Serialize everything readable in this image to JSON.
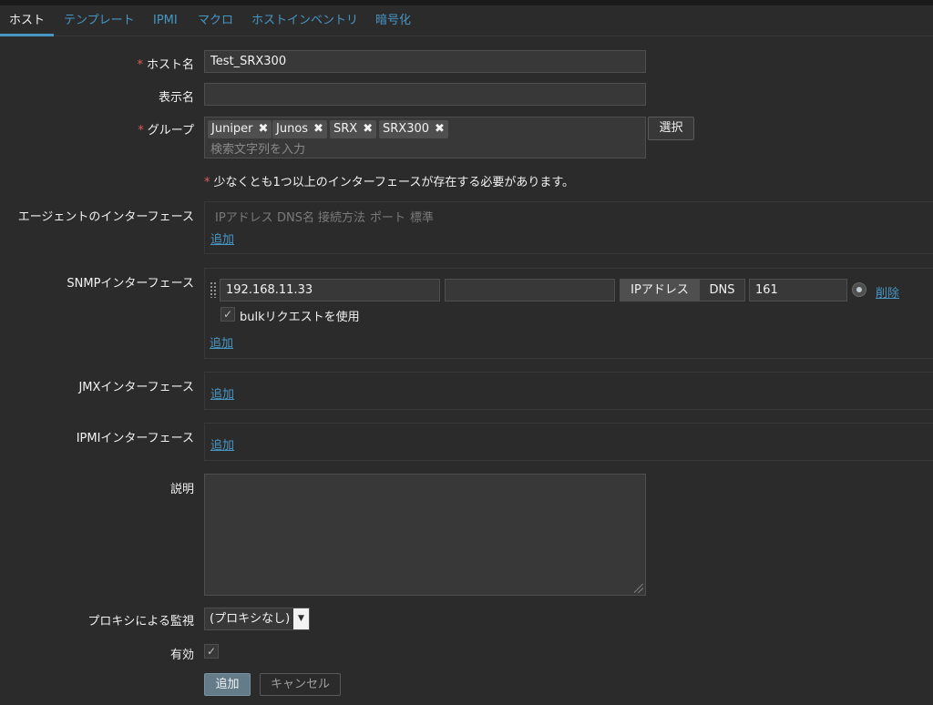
{
  "tabs": [
    "ホスト",
    "テンプレート",
    "IPMI",
    "マクロ",
    "ホストインベントリ",
    "暗号化"
  ],
  "host_name": {
    "label": "ホスト名",
    "value": "Test_SRX300"
  },
  "visible_name": {
    "label": "表示名",
    "value": ""
  },
  "groups": {
    "label": "グループ",
    "tags": [
      "Juniper",
      "Junos",
      "SRX",
      "SRX300"
    ],
    "tag_remove_icon": "✖",
    "search_placeholder": "検索文字列を入力",
    "select_button": "選択"
  },
  "interface_notice": "少なくとも1つ以上のインターフェースが存在する必要があります。",
  "required_marker": "*",
  "agent_interfaces": {
    "label": "エージェントのインターフェース",
    "columns": [
      "IPアドレス",
      "DNS名",
      "接続方法",
      "ポート",
      "標準"
    ],
    "add_link": "追加"
  },
  "snmp_interfaces": {
    "label": "SNMPインターフェース",
    "ip": "192.168.11.33",
    "dns": "",
    "connect_ip": "IPアドレス",
    "connect_dns": "DNS",
    "port": "161",
    "remove_link": "削除",
    "bulk_label": "bulkリクエストを使用",
    "bulk_checked": true,
    "add_link": "追加"
  },
  "jmx_interfaces": {
    "label": "JMXインターフェース",
    "add_link": "追加"
  },
  "ipmi_interfaces": {
    "label": "IPMIインターフェース",
    "add_link": "追加"
  },
  "description": {
    "label": "説明",
    "value": ""
  },
  "proxy": {
    "label": "プロキシによる監視",
    "selected": "(プロキシなし)"
  },
  "enabled": {
    "label": "有効",
    "checked": true
  },
  "buttons": {
    "add": "追加",
    "cancel": "キャンセル"
  },
  "colors": {
    "background": "#2b2b2b",
    "link": "#4796c4",
    "required": "#e45959",
    "primary": "#647c8a"
  }
}
